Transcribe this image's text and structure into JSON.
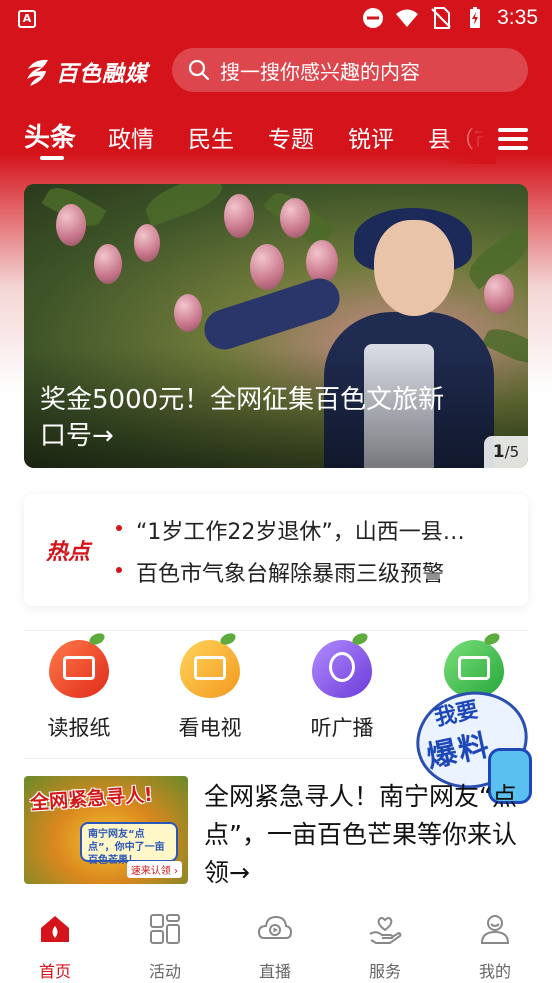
{
  "status_bar": {
    "time": "3:35",
    "left_icon": "A"
  },
  "header": {
    "logo_text": "百色融媒",
    "search_placeholder": "搜一搜你感兴趣的内容"
  },
  "tabs": [
    {
      "label": "头条",
      "active": true
    },
    {
      "label": "政情",
      "active": false
    },
    {
      "label": "民生",
      "active": false
    },
    {
      "label": "专题",
      "active": false
    },
    {
      "label": "锐评",
      "active": false
    },
    {
      "label": "县（市",
      "active": false
    }
  ],
  "banner": {
    "title": "奖金5000元！全网征集百色文旅新口号→",
    "current": "1",
    "total": "/5"
  },
  "hot": {
    "label": "热点",
    "items": [
      "“1岁工作22岁退休”，山西一县…",
      "百色市气象台解除暴雨三级预警"
    ]
  },
  "quick_entries": [
    {
      "label": "读报纸",
      "icon": "newspaper-icon"
    },
    {
      "label": "看电视",
      "icon": "tv-icon"
    },
    {
      "label": "听广播",
      "icon": "radio-icon"
    },
    {
      "label": "",
      "icon": "video-icon"
    }
  ],
  "report_badge": {
    "line1": "我要",
    "line2": "爆料"
  },
  "article": {
    "title": "全网紧急寻人！南宁网友“点点”，一亩百色芒果等你来认领→",
    "thumb_title": "全网紧急寻人!",
    "thumb_bubble": "南宁网友“点点”，你中了一亩百色芒果！",
    "thumb_tag": "速来认领 ›"
  },
  "bottom_nav": [
    {
      "label": "首页",
      "icon": "home-icon",
      "active": true
    },
    {
      "label": "活动",
      "icon": "activity-icon",
      "active": false
    },
    {
      "label": "直播",
      "icon": "live-icon",
      "active": false
    },
    {
      "label": "服务",
      "icon": "service-icon",
      "active": false
    },
    {
      "label": "我的",
      "icon": "profile-icon",
      "active": false
    }
  ],
  "colors": {
    "brand_red": "#d4131b",
    "text_dark": "#222222",
    "nav_inactive": "#666666"
  }
}
